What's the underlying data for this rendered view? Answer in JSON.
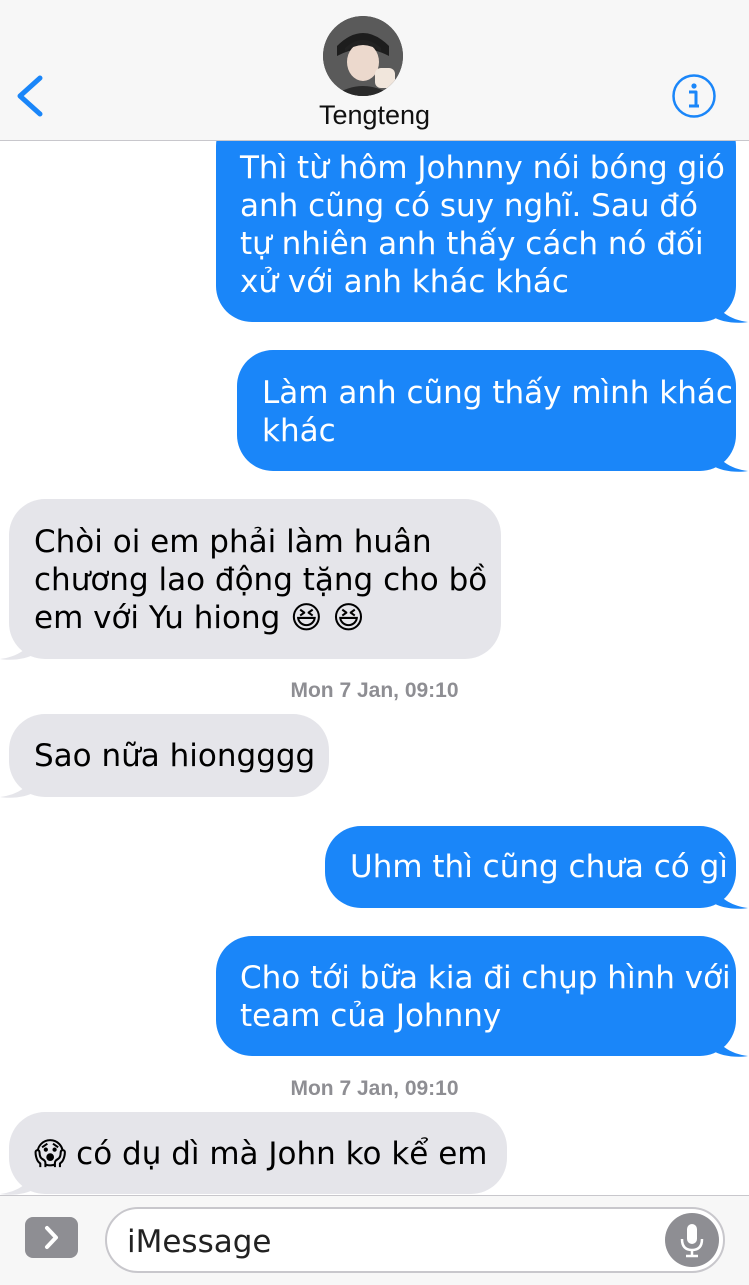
{
  "header": {
    "contact_name": "Tengteng",
    "accent_color": "#1a86f9",
    "back_icon": "chevron-left-icon",
    "info_icon": "info-icon"
  },
  "messages": [
    {
      "direction": "outgoing",
      "text": "Thì từ hôm Johnny nói bóng gió\nanh cũng có suy nghĩ. Sau đó\ntự nhiên anh thấy cách nó đối\nxử với anh khác khác"
    },
    {
      "direction": "outgoing",
      "text": "Làm anh cũng thấy mình khác\nkhác"
    },
    {
      "direction": "incoming",
      "text": "Chòi oi em phải làm huân\nchương lao động tặng cho bồ\nem với Yu hiong 😆 😆"
    },
    {
      "direction": "incoming",
      "text": "Sao nữa hiongggg"
    },
    {
      "direction": "outgoing",
      "text": "Uhm thì cũng chưa có gì"
    },
    {
      "direction": "outgoing",
      "text": "Cho tới bữa kia đi chụp hình với\nteam của Johnny"
    },
    {
      "direction": "incoming",
      "text": "😱 có dụ dì mà John ko kể em"
    }
  ],
  "timestamps": [
    "Mon 7 Jan, 09:10",
    "Mon 7 Jan, 09:10"
  ],
  "input": {
    "placeholder": "iMessage",
    "expand_icon": "chevron-right-icon",
    "mic_icon": "microphone-icon"
  },
  "colors": {
    "outgoing_bubble": "#1a86f9",
    "incoming_bubble": "#e5e5ea",
    "timestamp_text": "#8e8e93"
  }
}
